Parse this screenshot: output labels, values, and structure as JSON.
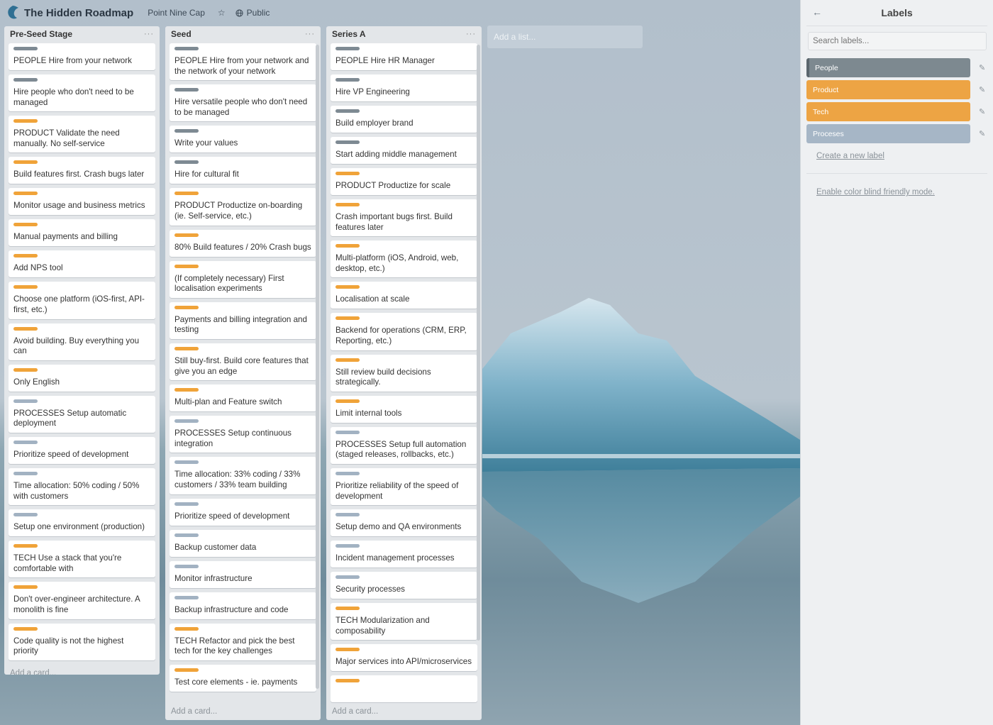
{
  "header": {
    "title": "The Hidden Roadmap",
    "team": "Point Nine Cap",
    "visibility": "Public"
  },
  "lists": [
    {
      "title": "Pre-Seed Stage",
      "add_card": "Add a card...",
      "cards": [
        {
          "label": "people",
          "text": "PEOPLE Hire from your network"
        },
        {
          "label": "people",
          "text": "Hire people who don't need to be managed"
        },
        {
          "label": "product",
          "text": "PRODUCT Validate the need manually. No self-service"
        },
        {
          "label": "product",
          "text": "Build features first. Crash bugs later"
        },
        {
          "label": "product",
          "text": "Monitor usage and business metrics"
        },
        {
          "label": "product",
          "text": "Manual payments and billing"
        },
        {
          "label": "product",
          "text": "Add NPS tool"
        },
        {
          "label": "product",
          "text": "Choose one platform (iOS-first, API-first, etc.)"
        },
        {
          "label": "product",
          "text": "Avoid building. Buy everything you can"
        },
        {
          "label": "product",
          "text": "Only English"
        },
        {
          "label": "processes",
          "text": "PROCESSES Setup automatic deployment"
        },
        {
          "label": "processes",
          "text": "Prioritize speed of development"
        },
        {
          "label": "processes",
          "text": "Time allocation: 50% coding / 50% with customers"
        },
        {
          "label": "processes",
          "text": "Setup one environment (production)"
        },
        {
          "label": "tech",
          "text": "TECH Use a stack that you're comfortable with"
        },
        {
          "label": "tech",
          "text": "Don't over-engineer architecture. A monolith is fine"
        },
        {
          "label": "tech",
          "text": "Code quality is not the highest priority"
        }
      ]
    },
    {
      "title": "Seed",
      "add_card": "Add a card...",
      "cards": [
        {
          "label": "people",
          "text": "PEOPLE Hire from your network and the network of your network"
        },
        {
          "label": "people",
          "text": "Hire versatile people who don't need to be managed"
        },
        {
          "label": "people",
          "text": "Write your values"
        },
        {
          "label": "people",
          "text": "Hire for cultural fit"
        },
        {
          "label": "product",
          "text": "PRODUCT Productize on-boarding (ie. Self-service, etc.)"
        },
        {
          "label": "product",
          "text": "80% Build features / 20% Crash bugs"
        },
        {
          "label": "product",
          "text": "(If completely necessary) First localisation experiments"
        },
        {
          "label": "product",
          "text": "Payments and billing integration and testing"
        },
        {
          "label": "product",
          "text": "Still buy-first. Build core features that give you an edge"
        },
        {
          "label": "product",
          "text": "Multi-plan and Feature switch"
        },
        {
          "label": "processes",
          "text": "PROCESSES Setup continuous integration"
        },
        {
          "label": "processes",
          "text": "Time allocation: 33% coding / 33% customers / 33% team building"
        },
        {
          "label": "processes",
          "text": "Prioritize speed of development"
        },
        {
          "label": "processes",
          "text": "Backup customer data"
        },
        {
          "label": "processes",
          "text": "Monitor infrastructure"
        },
        {
          "label": "processes",
          "text": "Backup infrastructure and code"
        },
        {
          "label": "tech",
          "text": "TECH Refactor and pick the best tech for the key challenges"
        },
        {
          "label": "tech",
          "text": "Test core elements - ie. payments"
        }
      ]
    },
    {
      "title": "Series A",
      "add_card": "Add a card...",
      "cards": [
        {
          "label": "people",
          "text": "PEOPLE Hire HR Manager"
        },
        {
          "label": "people",
          "text": "Hire VP Engineering"
        },
        {
          "label": "people",
          "text": "Build employer brand"
        },
        {
          "label": "people",
          "text": "Start adding middle management"
        },
        {
          "label": "product",
          "text": "PRODUCT Productize for scale"
        },
        {
          "label": "product",
          "text": "Crash important bugs first. Build features later"
        },
        {
          "label": "product",
          "text": "Multi-platform (iOS, Android, web, desktop, etc.)"
        },
        {
          "label": "product",
          "text": "Localisation at scale"
        },
        {
          "label": "product",
          "text": "Backend for operations (CRM, ERP, Reporting, etc.)"
        },
        {
          "label": "product",
          "text": "Still review build decisions strategically."
        },
        {
          "label": "product",
          "text": "Limit internal tools"
        },
        {
          "label": "processes",
          "text": "PROCESSES Setup full automation (staged releases, rollbacks, etc.)"
        },
        {
          "label": "processes",
          "text": "Prioritize reliability of the speed of development"
        },
        {
          "label": "processes",
          "text": "Setup demo and QA environments"
        },
        {
          "label": "processes",
          "text": "Incident management processes"
        },
        {
          "label": "processes",
          "text": "Security processes"
        },
        {
          "label": "tech",
          "text": "TECH Modularization and composability"
        },
        {
          "label": "tech",
          "text": "Major services into API/microservices"
        },
        {
          "label": "tech",
          "text": ""
        }
      ]
    }
  ],
  "add_list": "Add a list...",
  "sidebar": {
    "title": "Labels",
    "back_icon": "arrow-left-icon",
    "search_placeholder": "Search labels...",
    "labels": [
      {
        "name": "People",
        "color": "#7d8990"
      },
      {
        "name": "Product",
        "color": "#eda444"
      },
      {
        "name": "Tech",
        "color": "#eda444"
      },
      {
        "name": "Proceses",
        "color": "#a6b6c6"
      }
    ],
    "create_label": "Create a new label",
    "colorblind_mode": "Enable color blind friendly mode."
  }
}
